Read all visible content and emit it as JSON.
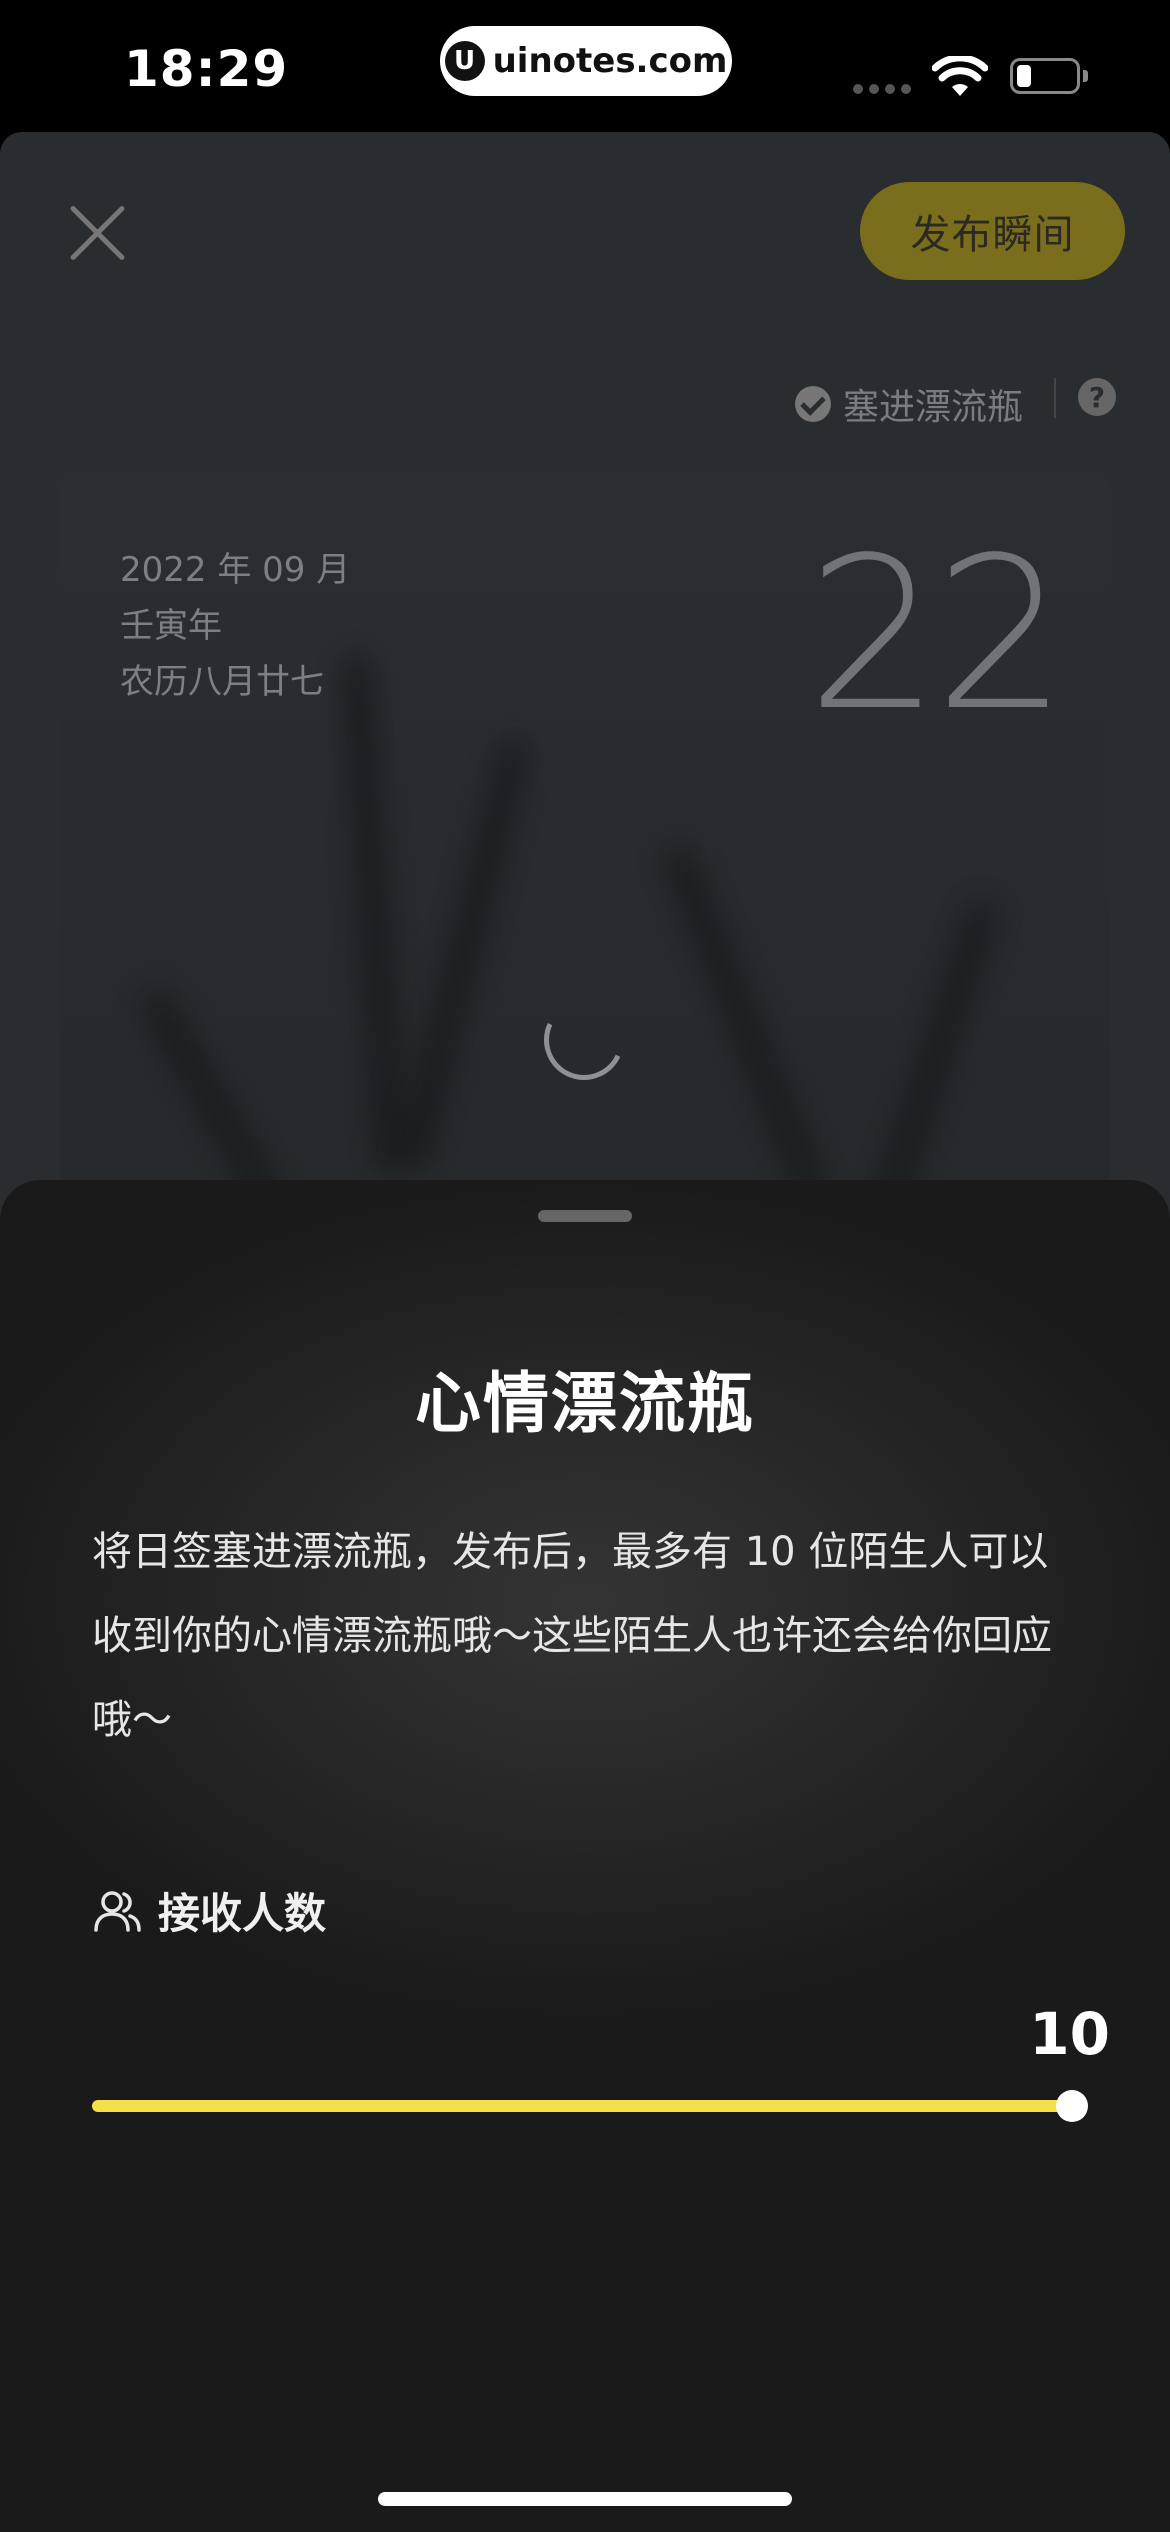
{
  "status_bar": {
    "time": "18:29",
    "url": "uinotes.com",
    "url_logo": "U"
  },
  "editor": {
    "publish_label": "发布瞬间",
    "bottle_toggle_label": "塞进漂流瓶",
    "help_label": "?",
    "card": {
      "date_line": "2022 年 09 月",
      "ganzhi_year": "壬寅年",
      "lunar_date": "农历八月廿七",
      "day": "22"
    }
  },
  "sheet": {
    "title": "心情漂流瓶",
    "description": "将日签塞进漂流瓶，发布后，最多有 10 位陌生人可以收到你的心情漂流瓶哦～这些陌生人也许还会给你回应哦～",
    "recipients_label": "接收人数",
    "recipients_value": "10",
    "slider_level": 1.0
  },
  "colors": {
    "accent_yellow": "#f5e04a",
    "publish_button": "#7a6e1c"
  },
  "icons": {
    "close": "close-icon",
    "check": "check-circle-icon",
    "help": "help-icon",
    "people": "people-icon",
    "wifi": "wifi-icon",
    "battery": "battery-icon"
  }
}
